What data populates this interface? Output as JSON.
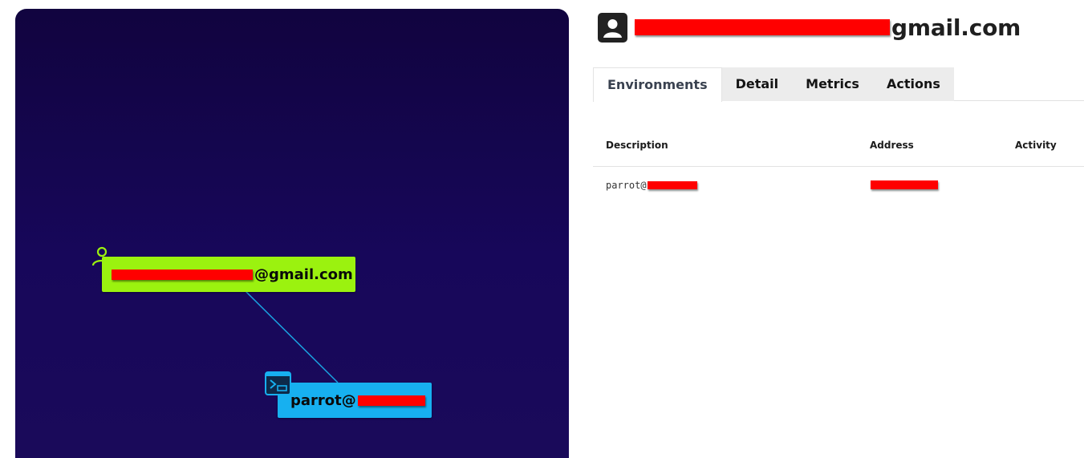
{
  "graph": {
    "user_node": {
      "label_suffix": "@gmail.com",
      "icon": "person-icon",
      "color": "#9bf20f"
    },
    "env_node": {
      "label_prefix": "parrot@",
      "icon": "terminal-icon",
      "color": "#17b0f0"
    },
    "edge_color": "#1aa3e0",
    "background": "#14064c"
  },
  "panel": {
    "header": {
      "avatar_icon": "account-box-icon",
      "title_suffix": "gmail.com"
    },
    "tabs": [
      {
        "label": "Environments",
        "active": true
      },
      {
        "label": "Detail",
        "active": false
      },
      {
        "label": "Metrics",
        "active": false
      },
      {
        "label": "Actions",
        "active": false
      }
    ],
    "table": {
      "columns": [
        "Description",
        "Address",
        "Activity"
      ],
      "rows": [
        {
          "description_prefix": "parrot@"
        }
      ]
    }
  }
}
